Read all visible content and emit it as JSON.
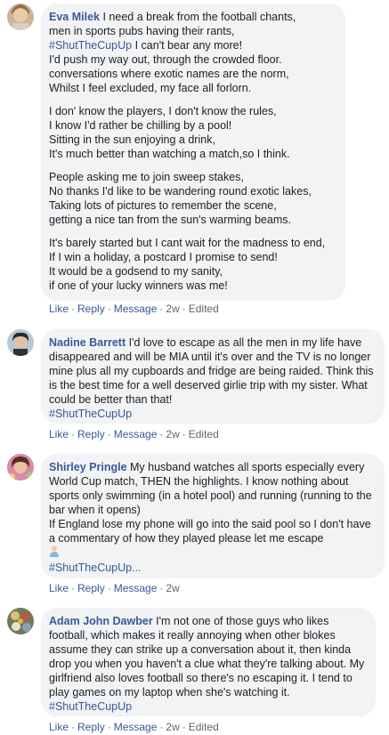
{
  "comments": [
    {
      "name": "Eva Milek",
      "paragraphs": [
        [
          "I need a break from the football chants,",
          "men in sports pubs having their rants,"
        ],
        [
          "I'd push my way out, through the crowded floor.",
          "conversations where exotic names are the norm,",
          "Whilst I feel excluded, my face all forlorn."
        ],
        [
          "I don' know the players, I don't know the rules,",
          "I know I'd rather be chilling by a pool!",
          "Sitting in the sun enjoying a drink,",
          "It's much better than watching a match,so I think."
        ],
        [
          "People asking me to join sweep stakes,",
          "No thanks I'd like to be wandering round exotic lakes,",
          "Taking lots of pictures to remember the scene,",
          "getting a nice tan from the sun's warming beams."
        ],
        [
          "It's barely started but I cant wait for the madness to end,",
          "If I win a holiday, a postcard I promise to send!",
          "It would be a godsend to my sanity,",
          "if one of your lucky winners was me!"
        ]
      ],
      "hashtag": "#ShutTheCupUp",
      "hashtag_suffix": " I can't bear any more!",
      "actions": {
        "like": "Like",
        "reply": "Reply",
        "message": "Message",
        "time": "2w",
        "edited": "Edited"
      }
    },
    {
      "name": "Nadine Barrett",
      "text": "I'd love to escape as all the men in my life have disappeared and will be MIA until it's over and the TV is no longer mine plus all my cupboards and fridge are being raided. Think this is the best time for a well deserved girlie trip with my sister. What could be better than that!",
      "hashtag": "#ShutTheCupUp",
      "actions": {
        "like": "Like",
        "reply": "Reply",
        "message": "Message",
        "time": "2w",
        "edited": "Edited"
      }
    },
    {
      "name": "Shirley Pringle",
      "text": "My husband watches all sports especially every World Cup match, THEN the highlights. I know nothing about sports only swimming (in a hotel pool) and running (running to the bar when it opens)",
      "text2": "If England lose my phone will go into the said pool so I don't have a commentary of how they played please let me escape",
      "hashtag": "#ShutTheCupUp...",
      "actions": {
        "like": "Like",
        "reply": "Reply",
        "message": "Message",
        "time": "2w"
      }
    },
    {
      "name": "Adam John Dawber",
      "text": "I'm not one of those guys who likes football, which makes it really annoying when other blokes assume they can strike up a conversation about it, then kinda drop you when you haven't a clue what they're talking about. My girlfriend also loves football so there's no escaping it. I tend to play games on my laptop when she's watching it.",
      "hashtag": "#ShutTheCupUp",
      "actions": {
        "like": "Like",
        "reply": "Reply",
        "message": "Message",
        "time": "2w",
        "edited": "Edited"
      }
    }
  ]
}
